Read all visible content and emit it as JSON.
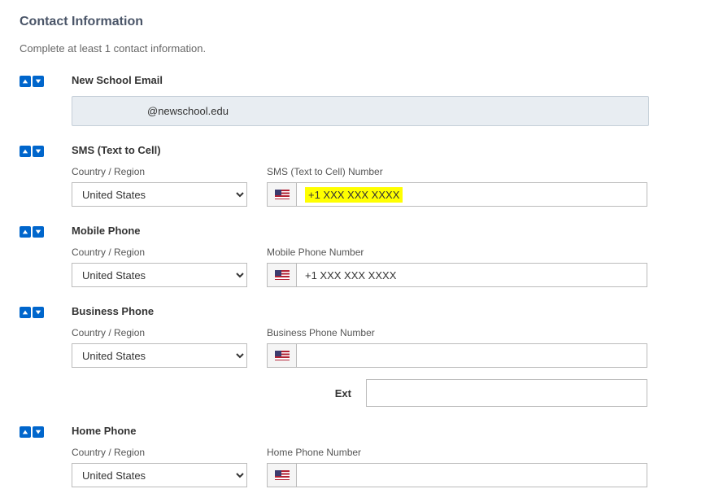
{
  "header": {
    "title": "Contact Information",
    "subtitle": "Complete at least 1 contact information."
  },
  "email": {
    "label": "New School Email",
    "value": "@newschool.edu"
  },
  "sms": {
    "label": "SMS (Text to Cell)",
    "country_label": "Country / Region",
    "country_value": "United States",
    "number_label": "SMS (Text to Cell) Number",
    "number_value": "+1 XXX XXX XXXX"
  },
  "mobile": {
    "label": "Mobile Phone",
    "country_label": "Country / Region",
    "country_value": "United States",
    "number_label": "Mobile Phone Number",
    "number_value": "+1 XXX XXX XXXX"
  },
  "business": {
    "label": "Business Phone",
    "country_label": "Country / Region",
    "country_value": "United States",
    "number_label": "Business Phone Number",
    "number_value": "",
    "ext_label": "Ext",
    "ext_value": ""
  },
  "home": {
    "label": "Home Phone",
    "country_label": "Country / Region",
    "country_value": "United States",
    "number_label": "Home Phone Number",
    "number_value": ""
  }
}
